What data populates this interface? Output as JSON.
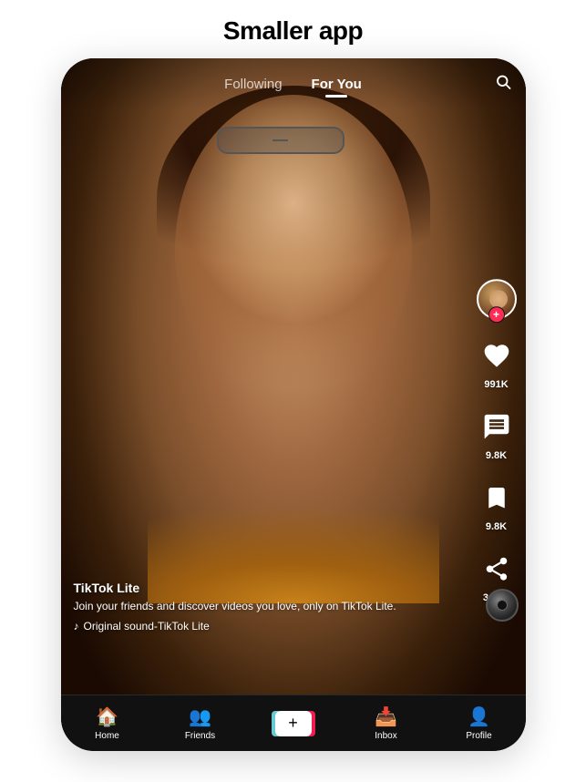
{
  "page": {
    "title": "Smaller app"
  },
  "header": {
    "tabs": [
      {
        "id": "following",
        "label": "Following",
        "active": false
      },
      {
        "id": "for-you",
        "label": "For You",
        "active": true
      }
    ],
    "search_label": "Search"
  },
  "actions": [
    {
      "id": "avatar",
      "type": "avatar",
      "label": ""
    },
    {
      "id": "like",
      "type": "heart",
      "label": "991K"
    },
    {
      "id": "comment",
      "type": "comment",
      "label": "9.8K"
    },
    {
      "id": "save",
      "type": "bookmark",
      "label": "9.8K"
    },
    {
      "id": "share",
      "type": "share",
      "label": "3.79K"
    }
  ],
  "video_info": {
    "creator": "TikTok Lite",
    "caption": "Join your friends and discover videos you love, only on TikTok Lite.",
    "sound": "Original sound-TikTok Lite"
  },
  "bottom_nav": [
    {
      "id": "home",
      "label": "Home",
      "icon": "🏠",
      "active": true
    },
    {
      "id": "friends",
      "label": "Friends",
      "icon": "👤",
      "active": false
    },
    {
      "id": "add",
      "label": "",
      "icon": "+",
      "type": "add"
    },
    {
      "id": "inbox",
      "label": "Inbox",
      "icon": "📥",
      "active": false
    },
    {
      "id": "profile",
      "label": "Profile",
      "icon": "👤",
      "active": false
    }
  ]
}
